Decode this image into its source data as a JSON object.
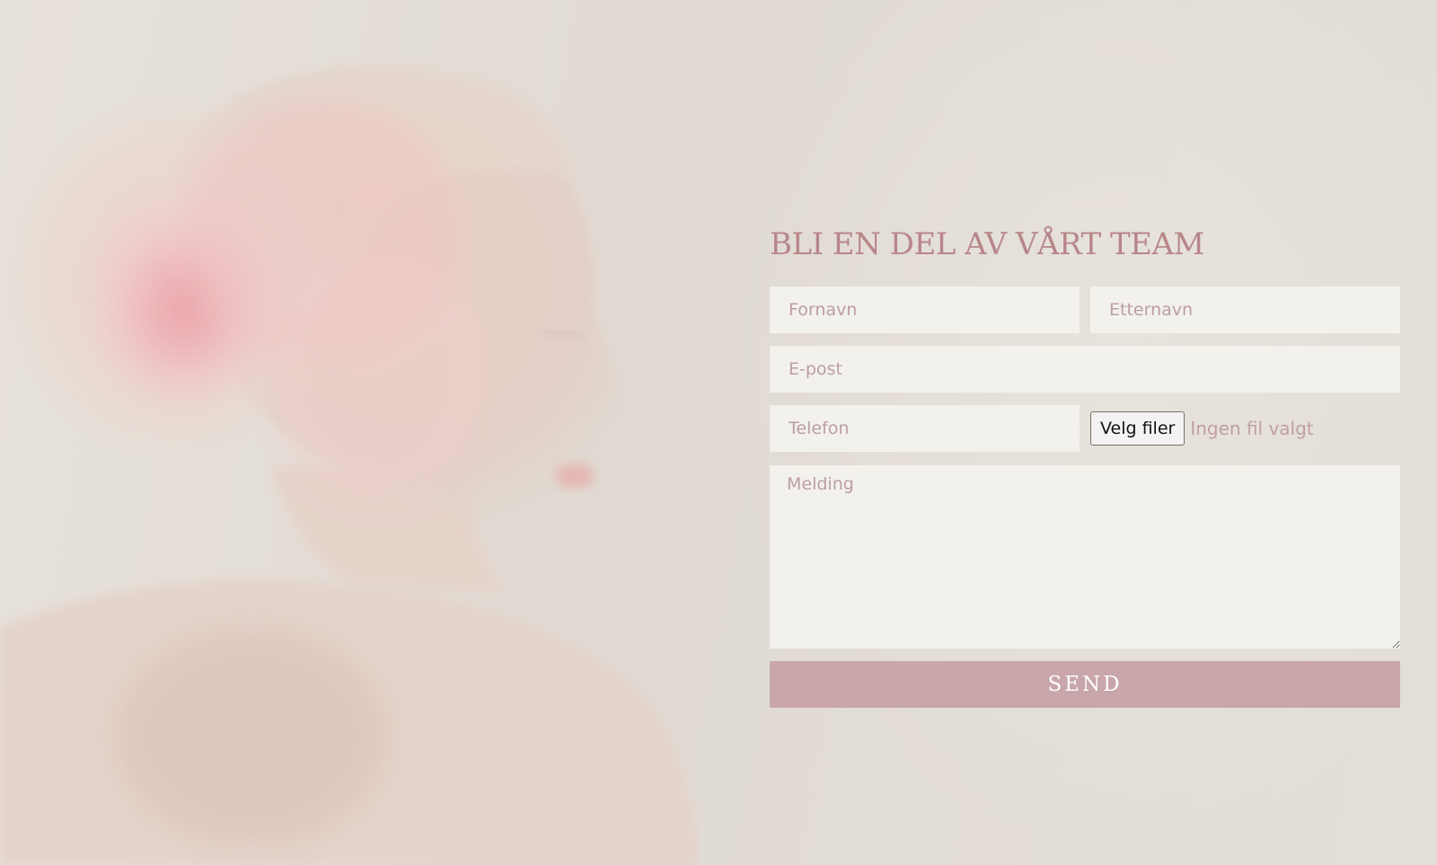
{
  "form": {
    "title": "BLI EN DEL AV VÅRT TEAM",
    "first_name_placeholder": "Fornavn",
    "last_name_placeholder": "Etternavn",
    "email_placeholder": "E-post",
    "phone_placeholder": "Telefon",
    "file_button_label": "Velg filer",
    "file_status": "Ingen fil valgt",
    "message_placeholder": "Melding",
    "submit_label": "SEND"
  },
  "colors": {
    "background": "#e2ddd6",
    "title": "#b8868a",
    "field_background": "#f3f1ec",
    "placeholder": "#bc9ea1",
    "submit_background": "#c9a6aa",
    "submit_text": "#ffffff"
  },
  "hero": {
    "image_subject": "woman-profile-with-pink-flower-overlay"
  }
}
